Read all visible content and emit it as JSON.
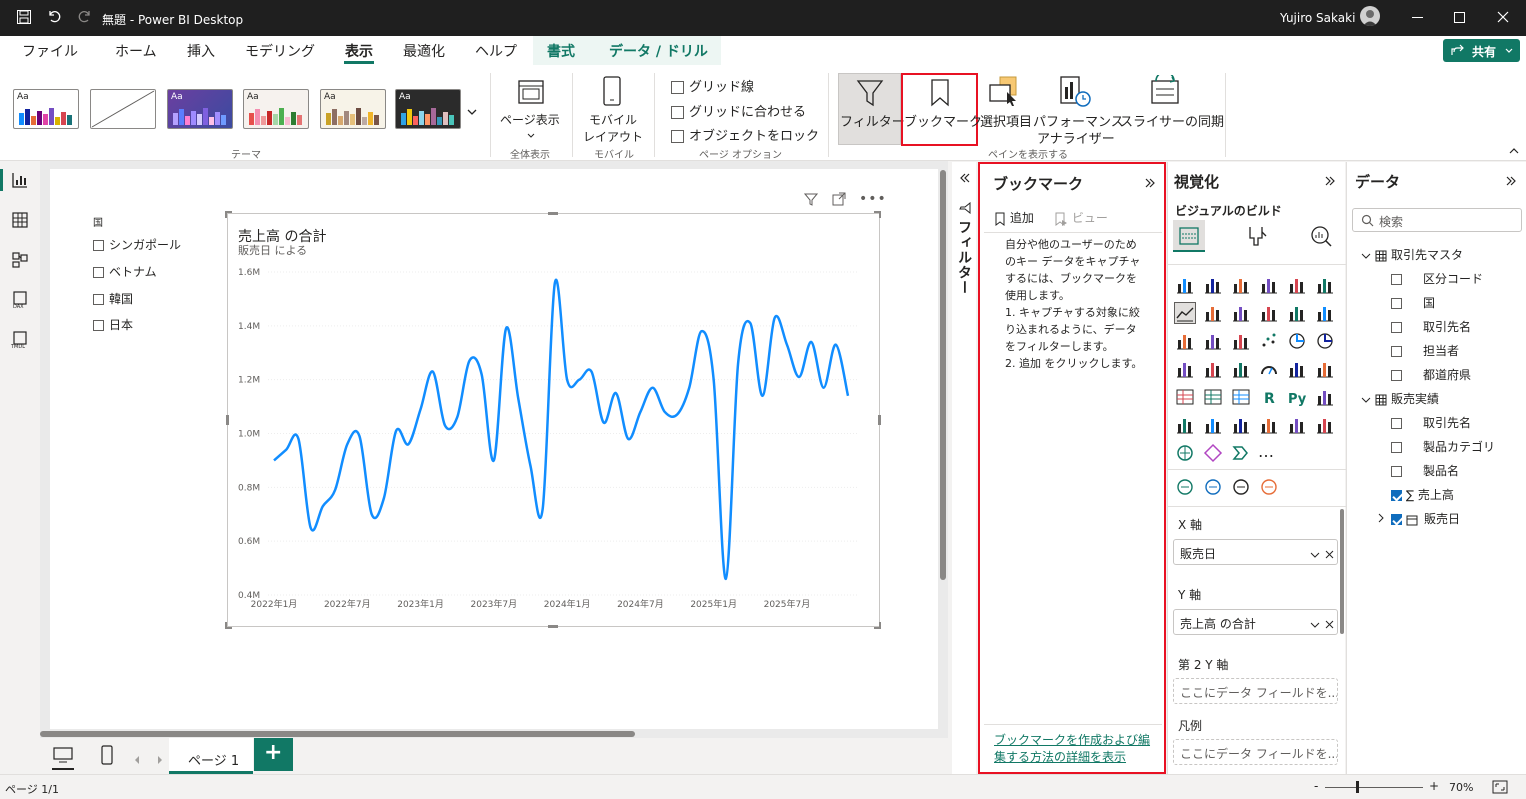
{
  "window": {
    "title": "無題 - Power BI Desktop",
    "user": "Yujiro Sakaki"
  },
  "menu": {
    "items": [
      "ファイル",
      "ホーム",
      "挿入",
      "モデリング",
      "表示",
      "最適化",
      "ヘルプ",
      "書式",
      "データ / ドリル"
    ],
    "active": "表示",
    "share_label": "共有"
  },
  "ribbon": {
    "themes_group": "テーマ",
    "theme_aa": "Aa",
    "page_view": "ページ表示",
    "fit_group": "全体表示",
    "mobile_layout_1": "モバイル",
    "mobile_layout_2": "レイアウト",
    "mobile_group": "モバイル",
    "gridlines": "グリッド線",
    "snap_to_grid": "グリッドに合わせる",
    "lock_objects": "オブジェクトをロック",
    "page_options_group": "ページ オプション",
    "filters": "フィルター",
    "bookmarks": "ブックマーク",
    "selection": "選択項目",
    "performance_1": "パフォーマンス",
    "performance_2": "アナライザー",
    "sync_slicers": "スライサーの同期",
    "show_panes_group": "ペインを表示する"
  },
  "slicer": {
    "title": "国",
    "items": [
      "シンガポール",
      "ベトナム",
      "韓国",
      "日本"
    ]
  },
  "chart_data": {
    "type": "line",
    "title": "売上高 の合計",
    "subtitle": "販売日 による",
    "xlabel": "",
    "ylabel": "",
    "y_ticks": [
      "1.6M",
      "1.4M",
      "1.2M",
      "1.0M",
      "0.8M",
      "0.6M",
      "0.4M"
    ],
    "x_ticks": [
      "2022年1月",
      "2022年7月",
      "2023年1月",
      "2023年7月",
      "2024年1月",
      "2024年7月",
      "2025年1月",
      "2025年7月"
    ],
    "ylim": [
      400000,
      1600000
    ],
    "color": "#118dff",
    "x": [
      "2022-01",
      "2022-02",
      "2022-03",
      "2022-04",
      "2022-05",
      "2022-06",
      "2022-07",
      "2022-08",
      "2022-09",
      "2022-10",
      "2022-11",
      "2022-12",
      "2023-01",
      "2023-02",
      "2023-03",
      "2023-04",
      "2023-05",
      "2023-06",
      "2023-07",
      "2023-08",
      "2023-09",
      "2023-10",
      "2023-11",
      "2023-12",
      "2024-01",
      "2024-02",
      "2024-03",
      "2024-04",
      "2024-05",
      "2024-06",
      "2024-07",
      "2024-08",
      "2024-09",
      "2024-10",
      "2024-11",
      "2024-12",
      "2025-01",
      "2025-02",
      "2025-03",
      "2025-04",
      "2025-05",
      "2025-06",
      "2025-07",
      "2025-08",
      "2025-09",
      "2025-10",
      "2025-11",
      "2025-12"
    ],
    "values": [
      900000,
      940000,
      980000,
      650000,
      730000,
      790000,
      960000,
      990000,
      700000,
      760000,
      1010000,
      960000,
      1090000,
      1230000,
      1030000,
      1060000,
      1270000,
      1220000,
      900000,
      1390000,
      1130000,
      880000,
      720000,
      1560000,
      1200000,
      1200000,
      1230000,
      1040000,
      1150000,
      980000,
      1080000,
      1170000,
      1080000,
      1070000,
      1170000,
      1380000,
      1200000,
      460000,
      1260000,
      1410000,
      1140000,
      1430000,
      1330000,
      1210000,
      1340000,
      1170000,
      1330000,
      1140000
    ]
  },
  "bookmark_pane": {
    "title": "ブックマーク",
    "add": "追加",
    "view": "ビュー",
    "body": "自分や他のユーザーのためのキー データをキャプチャするには、ブックマークを使用します。\n1. キャプチャする対象に絞り込まれるように、データをフィルターします。\n2. 追加 をクリックします。",
    "link": "ブックマークを作成および編集する方法の詳細を表示"
  },
  "filter_pane": {
    "label": "フィルター"
  },
  "viz_pane": {
    "title": "視覚化",
    "build": "ビジュアルのビルド",
    "more": "…",
    "x_axis": "X 軸",
    "x_field": "販売日",
    "y_axis": "Y 軸",
    "y_field": "売上高 の合計",
    "y2_axis": "第 2 Y 軸",
    "y2_placeholder": "ここにデータ フィールドを...",
    "legend": "凡例",
    "legend_placeholder": "ここにデータ フィールドを..."
  },
  "data_pane": {
    "title": "データ",
    "search_placeholder": "検索",
    "tables": [
      {
        "name": "取引先マスタ",
        "fields": [
          {
            "name": "区分コード",
            "checked": false
          },
          {
            "name": "国",
            "checked": false
          },
          {
            "name": "取引先名",
            "checked": false
          },
          {
            "name": "担当者",
            "checked": false
          },
          {
            "name": "都道府県",
            "checked": false
          }
        ]
      },
      {
        "name": "販売実績",
        "fields": [
          {
            "name": "取引先名",
            "checked": false
          },
          {
            "name": "製品カテゴリ",
            "checked": false
          },
          {
            "name": "製品名",
            "checked": false
          },
          {
            "name": "売上高",
            "checked": true,
            "sigma": "∑"
          },
          {
            "name": "販売日",
            "checked": true
          }
        ]
      }
    ]
  },
  "page_tabs": {
    "page1": "ページ 1",
    "add": "+"
  },
  "status": {
    "page": "ページ 1/1",
    "zoom": "70%",
    "minus": "-",
    "plus": "+"
  }
}
